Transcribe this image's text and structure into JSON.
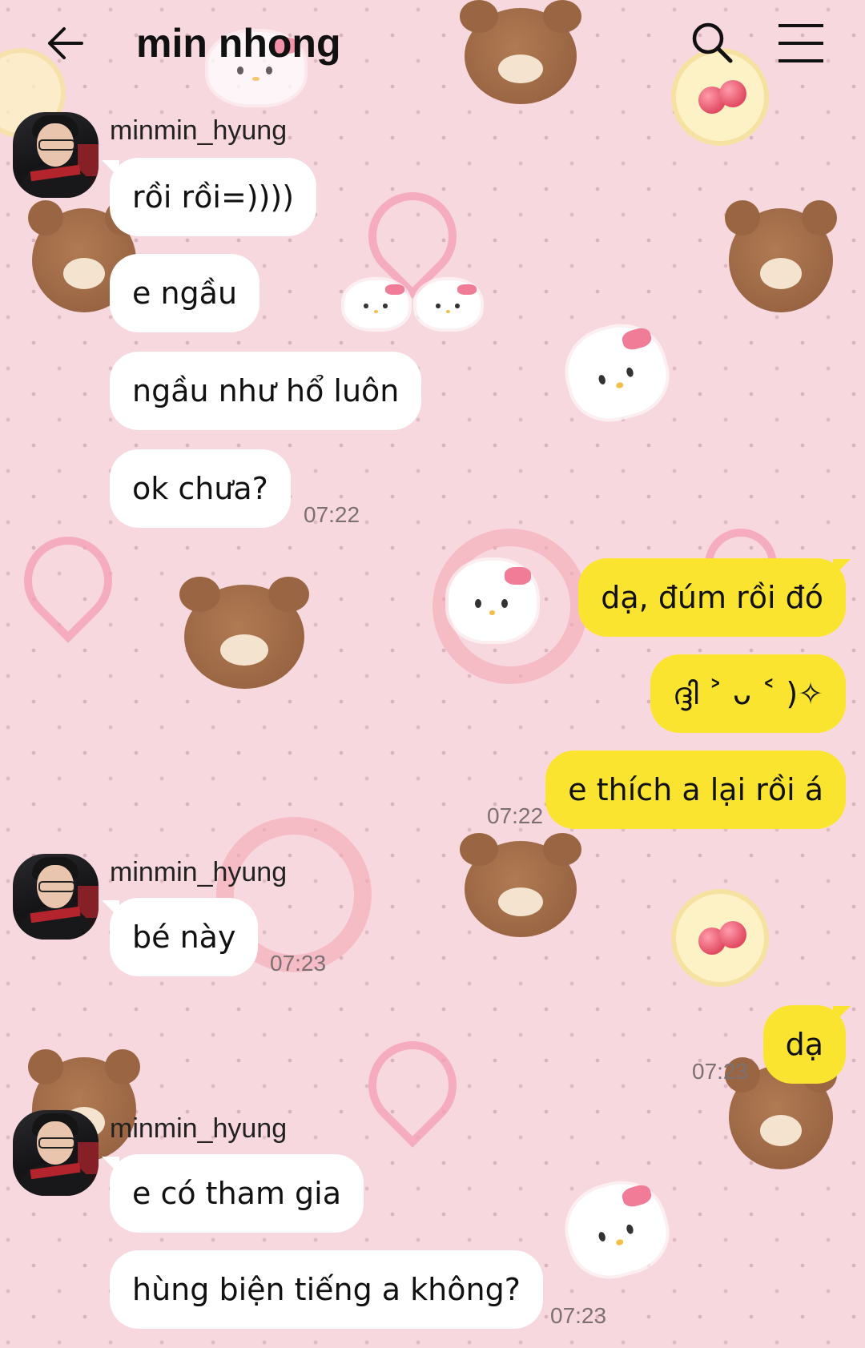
{
  "header": {
    "title": "min nhong",
    "back_icon": "back-arrow-icon",
    "search_icon": "search-icon",
    "menu_icon": "hamburger-menu-icon"
  },
  "colors": {
    "background": "#f8d8df",
    "incoming_bubble": "#ffffff",
    "outgoing_bubble": "#fbe430",
    "timestamp": "#7b7072"
  },
  "messages": [
    {
      "sender": "minmin_hyung",
      "bubbles": [
        "rồi rồi=))))",
        "e ngầu",
        "ngầu như hổ luôn",
        "ok chưa?"
      ],
      "time": "07:22"
    },
    {
      "sender": "me",
      "bubbles": [
        "dạ, đúm rồi đó",
        "ദ്ദി ˃ ᴗ ˂ )✧",
        "e thích a lại rồi á"
      ],
      "time": "07:22"
    },
    {
      "sender": "minmin_hyung",
      "bubbles": [
        "bé này"
      ],
      "time": "07:23"
    },
    {
      "sender": "me",
      "bubbles": [
        "dạ"
      ],
      "time": "07:23"
    },
    {
      "sender": "minmin_hyung",
      "bubbles": [
        "e có tham gia",
        "hùng biện tiếng a không?"
      ],
      "time": "07:23"
    }
  ]
}
